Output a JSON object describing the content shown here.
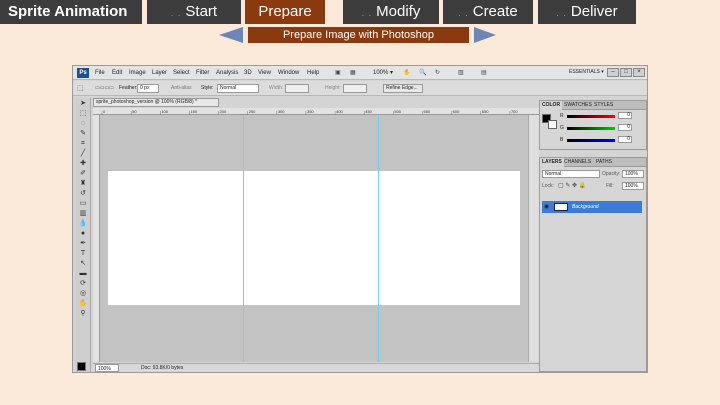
{
  "nav": {
    "title": "Sprite Animation",
    "tabs": [
      {
        "label": "Start",
        "active": false
      },
      {
        "label": "Prepare",
        "active": true
      },
      {
        "label": "Modify",
        "active": false
      },
      {
        "label": "Create",
        "active": false
      },
      {
        "label": "Deliver",
        "active": false
      }
    ]
  },
  "subtitle": "Prepare Image with Photoshop",
  "photoshop": {
    "logo": "Ps",
    "menus": [
      "File",
      "Edit",
      "Image",
      "Layer",
      "Select",
      "Filter",
      "Analysis",
      "3D",
      "View",
      "Window",
      "Help"
    ],
    "zoom_menu": "100% ▾",
    "workspace": "ESSENTIALS ▾",
    "options": {
      "feather_label": "Feather:",
      "feather_value": "0 px",
      "antialias": "Anti-alias",
      "style_label": "Style:",
      "style_value": "Normal",
      "width_label": "Width:",
      "height_label": "Height:",
      "refine_edge": "Refine Edge..."
    },
    "doc_tab": "sprite_photoshop_version @ 100% (RGB/8) *",
    "ruler_marks": [
      "0",
      "50",
      "100",
      "150",
      "200",
      "250",
      "300",
      "350",
      "400",
      "450",
      "500",
      "550",
      "600",
      "650",
      "700"
    ],
    "status_zoom": "100%",
    "status_doc": "Doc: 93.8K/0 bytes",
    "color_panel": {
      "tabs": [
        "COLOR",
        "SWATCHES",
        "STYLES"
      ],
      "channels": [
        {
          "label": "R",
          "value": "0",
          "color": "#d33"
        },
        {
          "label": "G",
          "value": "0",
          "color": "#3b3"
        },
        {
          "label": "B",
          "value": "0",
          "color": "#33d"
        }
      ]
    },
    "layers_panel": {
      "tabs": [
        "LAYERS",
        "CHANNELS",
        "PATHS"
      ],
      "blend_mode": "Normal",
      "opacity_label": "Opacity:",
      "opacity_value": "100%",
      "lock_label": "Lock:",
      "fill_label": "Fill:",
      "fill_value": "100%",
      "layer_name": "Background"
    }
  }
}
